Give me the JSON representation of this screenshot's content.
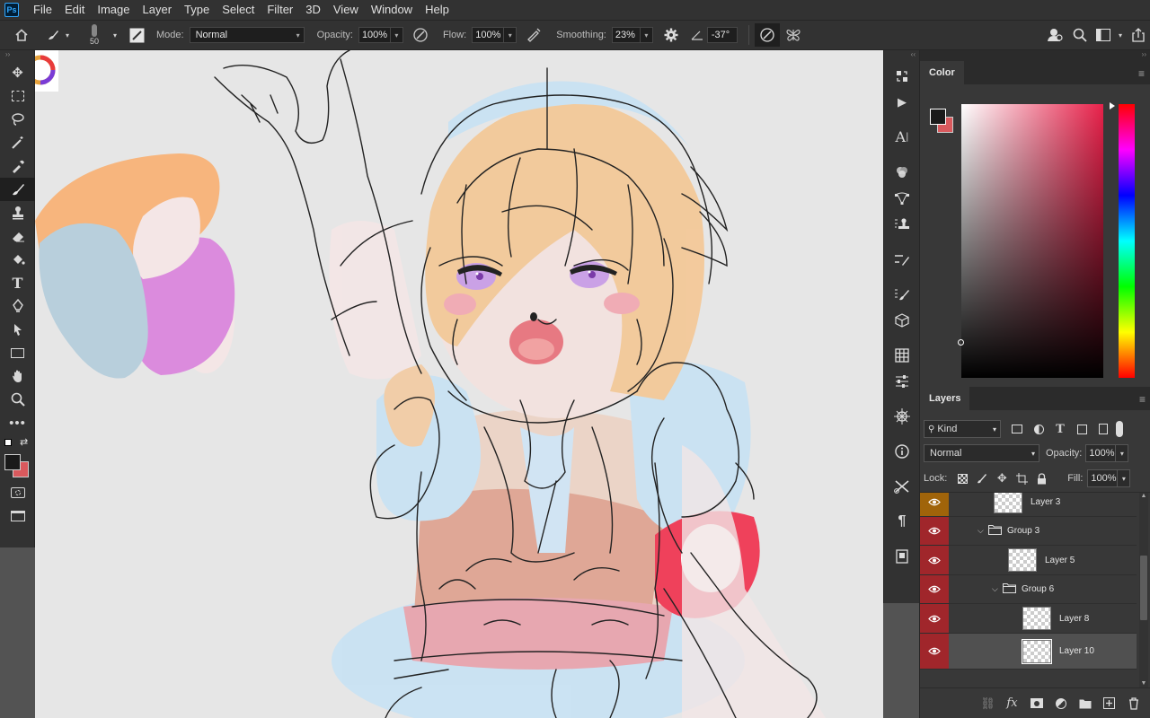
{
  "menubar": {
    "logo": "Ps",
    "items": [
      "File",
      "Edit",
      "Image",
      "Layer",
      "Type",
      "Select",
      "Filter",
      "3D",
      "View",
      "Window",
      "Help"
    ]
  },
  "options": {
    "brush_size": "50",
    "mode_label": "Mode:",
    "mode_value": "Normal",
    "opacity_label": "Opacity:",
    "opacity_value": "100%",
    "flow_label": "Flow:",
    "flow_value": "100%",
    "smoothing_label": "Smoothing:",
    "smoothing_value": "23%",
    "angle_value": "-37°"
  },
  "toolbar": {
    "tools": [
      "move-tool",
      "marquee-tool",
      "lasso-tool",
      "magic-wand-tool",
      "eyedropper-tool",
      "brush-tool",
      "stamp-tool",
      "eraser-tool",
      "paint-bucket-tool",
      "type-tool",
      "pen-tool",
      "path-selection-tool",
      "rectangle-tool",
      "hand-tool",
      "zoom-tool",
      "more-tools"
    ],
    "active": "brush-tool",
    "foreground_color": "#1a1a1a",
    "background_color": "#d9595d"
  },
  "color_panel": {
    "tab": "Color",
    "hue_color": "#e8214a"
  },
  "layers_panel": {
    "tab": "Layers",
    "filter_label": "Kind",
    "blend_mode": "Normal",
    "opacity_label": "Opacity:",
    "opacity_value": "100%",
    "lock_label": "Lock:",
    "fill_label": "Fill:",
    "fill_value": "100%",
    "layers": [
      {
        "name": "Layer 3",
        "type": "layer",
        "indent": 0,
        "eye_color": "#a0640a",
        "selected": false
      },
      {
        "name": "Group 3",
        "type": "group",
        "indent": 1,
        "eye_color": "#a0262b",
        "selected": false
      },
      {
        "name": "Layer 5",
        "type": "layer",
        "indent": 1,
        "eye_color": "#a0262b",
        "selected": false
      },
      {
        "name": "Group 6",
        "type": "group",
        "indent": 2,
        "eye_color": "#a0262b",
        "selected": false
      },
      {
        "name": "Layer 8",
        "type": "layer",
        "indent": 2,
        "eye_color": "#a0262b",
        "selected": false
      },
      {
        "name": "Layer 10",
        "type": "layer",
        "indent": 2,
        "eye_color": "#a0262b",
        "selected": true
      }
    ]
  }
}
